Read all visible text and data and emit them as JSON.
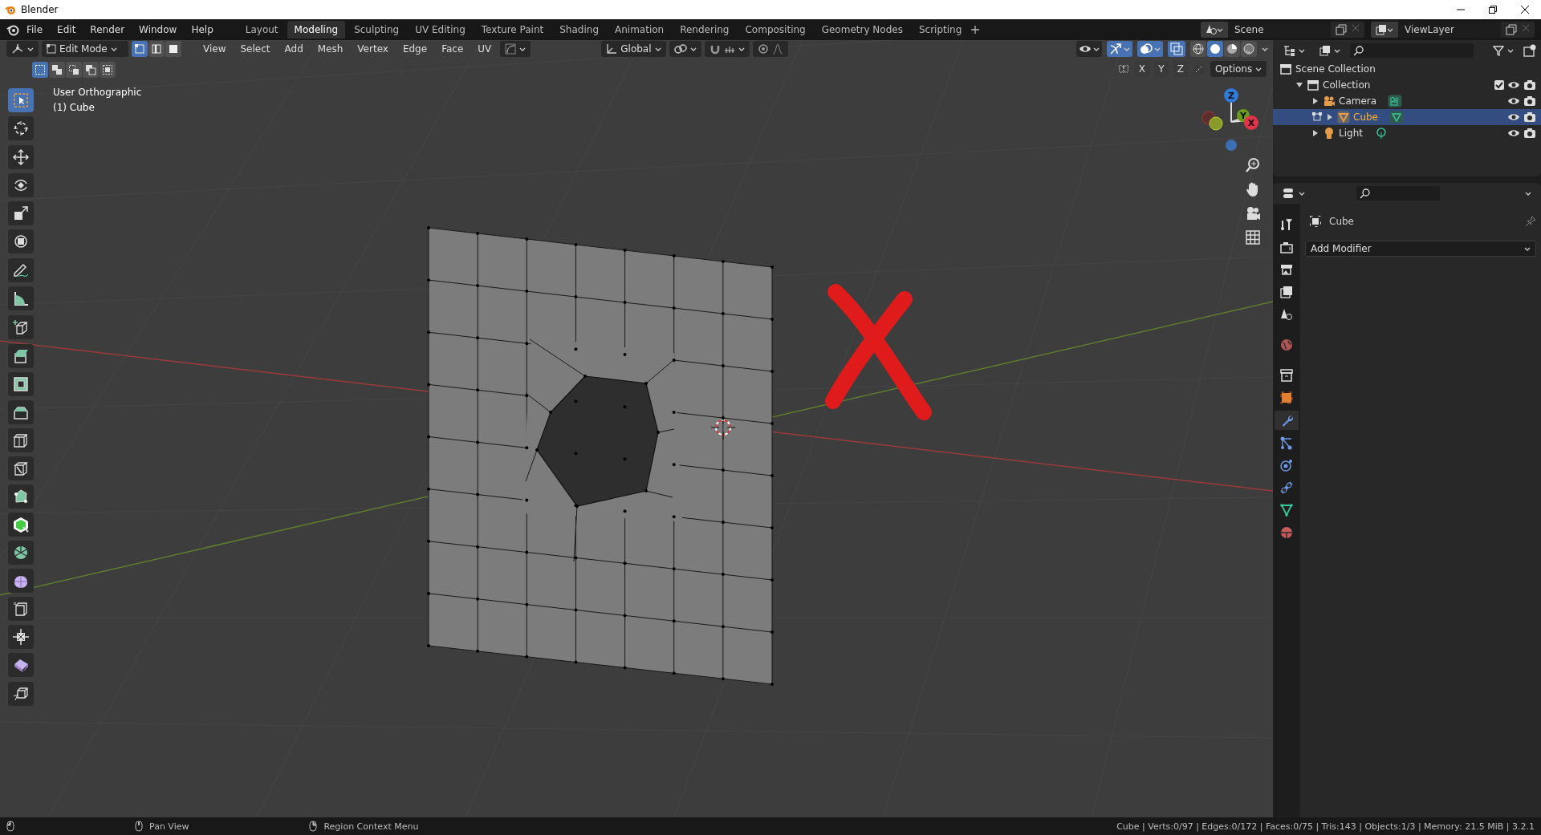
{
  "title_bar": {
    "title": "Blender"
  },
  "menu": [
    "File",
    "Edit",
    "Render",
    "Window",
    "Help"
  ],
  "workspaces": [
    {
      "label": "Layout",
      "selected": false
    },
    {
      "label": "Modeling",
      "selected": true
    },
    {
      "label": "Sculpting",
      "selected": false
    },
    {
      "label": "UV Editing",
      "selected": false
    },
    {
      "label": "Texture Paint",
      "selected": false
    },
    {
      "label": "Shading",
      "selected": false
    },
    {
      "label": "Animation",
      "selected": false
    },
    {
      "label": "Rendering",
      "selected": false
    },
    {
      "label": "Compositing",
      "selected": false
    },
    {
      "label": "Geometry Nodes",
      "selected": false
    },
    {
      "label": "Scripting",
      "selected": false
    }
  ],
  "scene": {
    "value": "Scene"
  },
  "view_layer": {
    "value": "ViewLayer"
  },
  "viewport_header": {
    "mode": "Edit Mode",
    "select_modes": [
      {
        "selected": true
      },
      {
        "selected": false
      },
      {
        "selected": false
      }
    ],
    "menus": [
      "View",
      "Select",
      "Add",
      "Mesh",
      "Vertex",
      "Edge",
      "Face",
      "UV"
    ],
    "orientation": "Global",
    "shading": [
      {
        "selected": false
      },
      {
        "selected": true
      },
      {
        "selected": false
      },
      {
        "selected": false
      }
    ],
    "mirror_axes": [
      "X",
      "Y",
      "Z"
    ],
    "options": "Options"
  },
  "selection_modes": [
    {
      "selected": true
    },
    {
      "selected": false
    },
    {
      "selected": false
    },
    {
      "selected": false
    },
    {
      "selected": false
    }
  ],
  "viewport": {
    "view_name": "User Orthographic",
    "object_name": "(1) Cube",
    "gizmo_axes": [
      "Z",
      "Y",
      "X"
    ]
  },
  "tool_groups": [
    [
      {
        "selected": true
      },
      {
        "selected": false
      }
    ],
    [
      {
        "selected": false
      },
      {
        "selected": false
      },
      {
        "selected": false
      },
      {
        "selected": false
      }
    ],
    [
      {
        "selected": false
      },
      {
        "selected": false
      }
    ],
    [
      {
        "selected": false
      }
    ],
    [
      {
        "selected": false
      },
      {
        "selected": false
      },
      {
        "selected": false
      },
      {
        "selected": false
      },
      {
        "selected": false
      },
      {
        "selected": false
      },
      {
        "selected": false
      },
      {
        "selected": false
      },
      {
        "selected": false
      },
      {
        "selected": false
      },
      {
        "selected": false
      },
      {
        "selected": false
      }
    ],
    [
      {
        "selected": false
      }
    ]
  ],
  "outliner": {
    "items": [
      {
        "label": "Scene Collection",
        "kind": "scene",
        "selected": false,
        "children": [
          {
            "label": "Collection",
            "kind": "collection",
            "selected": false,
            "expanded": true,
            "checked": true,
            "children": [
              {
                "label": "Camera",
                "kind": "camera",
                "selected": false,
                "expanded": false
              },
              {
                "label": "Cube",
                "kind": "mesh",
                "selected": true,
                "expanded": false
              },
              {
                "label": "Light",
                "kind": "light",
                "selected": false,
                "expanded": false
              }
            ]
          }
        ]
      }
    ]
  },
  "properties": {
    "tabs": [
      {
        "selected": false
      },
      {
        "selected": false
      },
      {
        "selected": false
      },
      {
        "selected": false
      },
      {
        "selected": false
      },
      {
        "selected": false
      },
      {
        "selected": false
      },
      {
        "selected": false
      },
      {
        "selected": true
      },
      {
        "selected": false
      },
      {
        "selected": false
      },
      {
        "selected": false
      },
      {
        "selected": false
      },
      {
        "selected": false
      }
    ],
    "object_name": "Cube",
    "add_modifier": "Add Modifier"
  },
  "status_bar": {
    "hints": [
      "Pan View",
      "Region Context Menu"
    ],
    "stats": "Cube | Verts:0/97 | Edges:0/172 | Faces:0/75 | Tris:143 | Objects:1/3 | Memory: 21.5 MiB | 3.2.1"
  }
}
